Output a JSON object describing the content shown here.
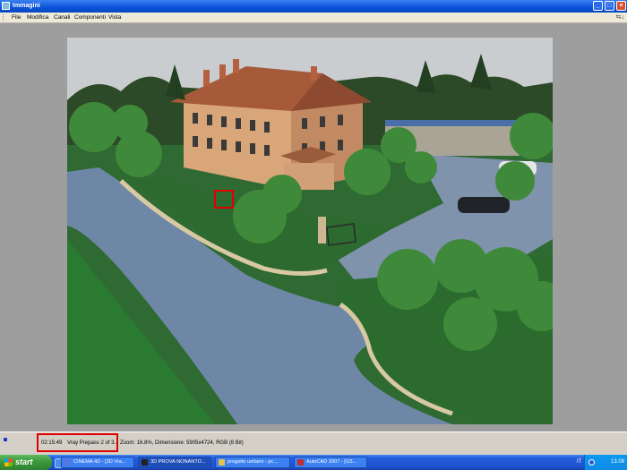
{
  "window": {
    "title": "Immagini"
  },
  "menu": {
    "items": [
      "File",
      "Modifica",
      "Canali",
      "Componenti",
      "Vista"
    ],
    "nav_arrows": "⇆↓"
  },
  "status": {
    "time": "02:15:49",
    "pass": "Vray Prepass 2 of 3...",
    "info": "Zoom: 16.8%, Dimensione: 5905x4724, RGB (8 Bit)"
  },
  "taskbar": {
    "start_label": "start",
    "tasks": [
      {
        "label": "CINEMA 4D - [3D Vra...",
        "icon_color": "#5577dd"
      },
      {
        "label": "3D PROVA NONANTO...",
        "icon_color": "#222222"
      },
      {
        "label": "progetto unitario - pc...",
        "icon_color": "#e8c050"
      },
      {
        "label": "AutoCAD 2007 - [\\15...",
        "icon_color": "#c03030"
      }
    ],
    "language": "IT",
    "clock": "13.08"
  },
  "colors": {
    "titlebar": "#0a52d8",
    "highlight": "#e00000",
    "workspace": "#9e9e9e"
  }
}
